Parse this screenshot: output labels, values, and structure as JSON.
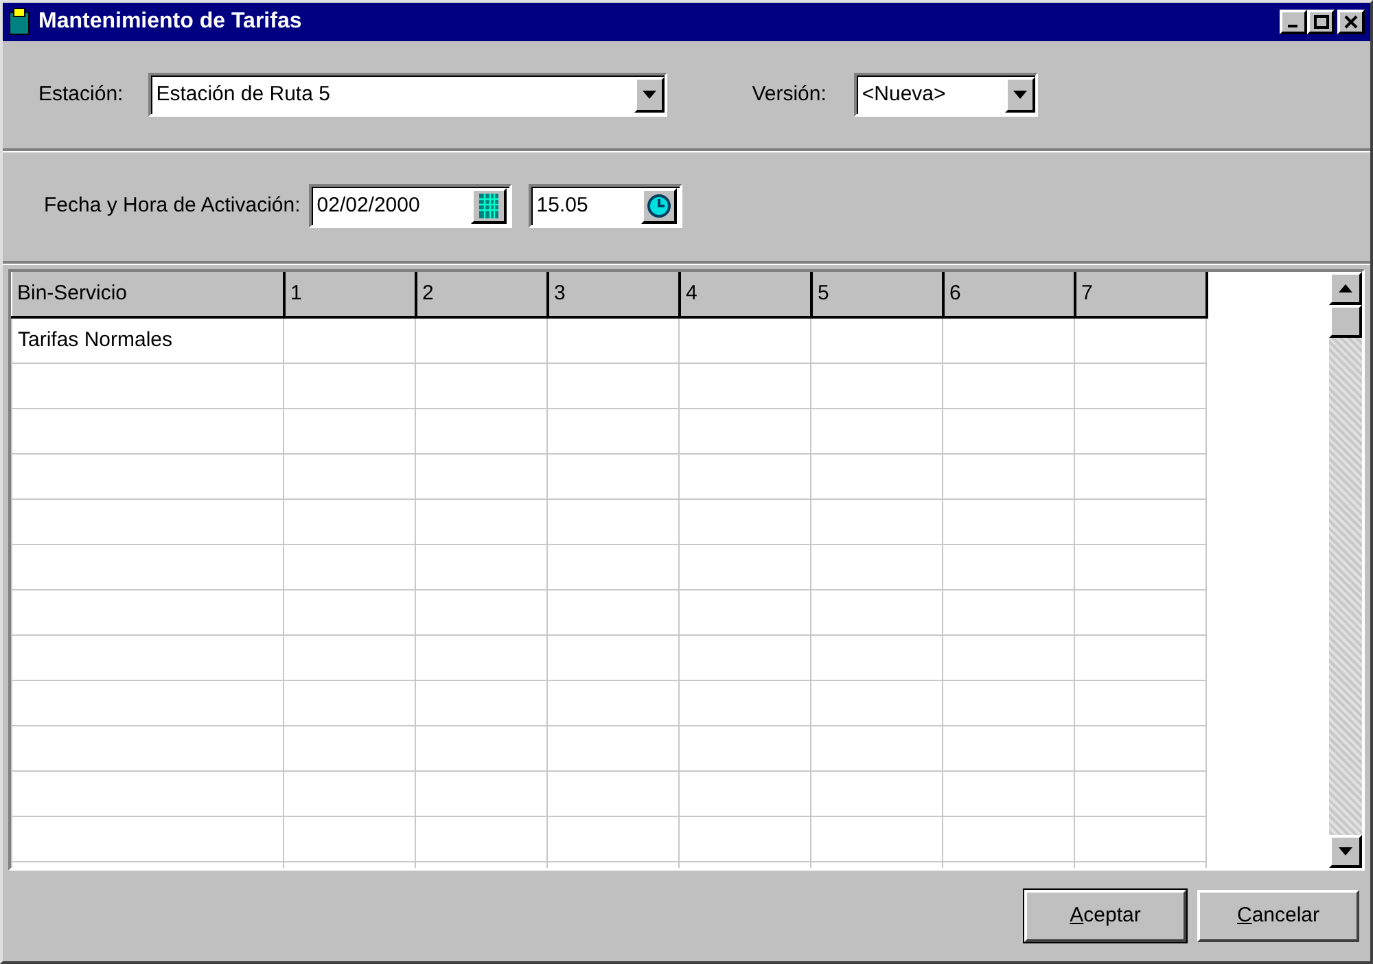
{
  "window": {
    "title": "Mantenimiento de Tarifas"
  },
  "station": {
    "label": "Estación:",
    "value": "Estación de Ruta 5"
  },
  "version": {
    "label": "Versión:",
    "value": "<Nueva>"
  },
  "activation": {
    "label": "Fecha y Hora de Activación:",
    "date": "02/02/2000",
    "time": "15.05"
  },
  "grid": {
    "columns": [
      "Bin-Servicio",
      "1",
      "2",
      "3",
      "4",
      "5",
      "6",
      "7"
    ],
    "rows": [
      {
        "cells": [
          "Tarifas Normales"
        ]
      }
    ]
  },
  "buttons": [
    {
      "label": "Aceptar",
      "first_letter_underlined": true,
      "default": true
    },
    {
      "label": "Cancelar",
      "first_letter_underlined": true,
      "default": false
    }
  ]
}
